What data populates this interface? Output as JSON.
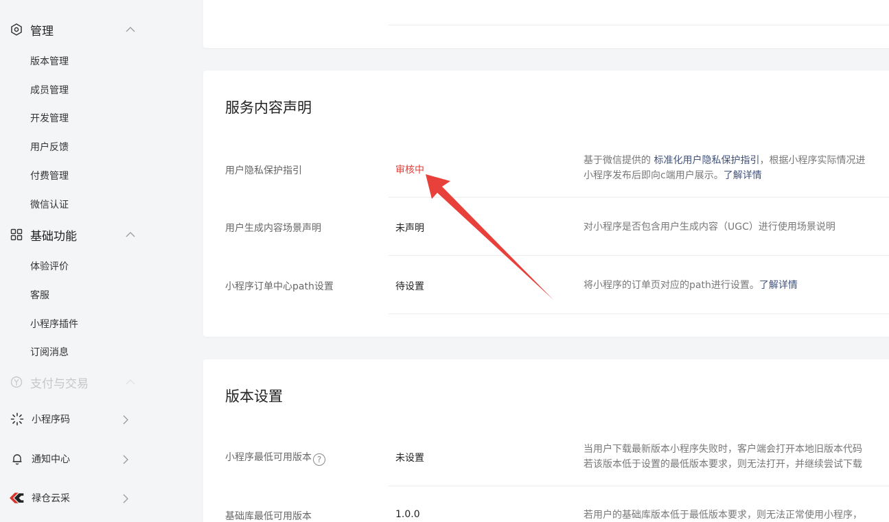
{
  "sidebar": {
    "management": {
      "label": "管理",
      "items": [
        "版本管理",
        "成员管理",
        "开发管理",
        "用户反馈",
        "付费管理",
        "微信认证"
      ]
    },
    "basic": {
      "label": "基础功能",
      "items": [
        "体验评价",
        "客服",
        "小程序插件",
        "订阅消息"
      ]
    },
    "payment": {
      "label": "支付与交易"
    },
    "bottom": [
      {
        "label": "小程序码",
        "icon": "qrcode-icon"
      },
      {
        "label": "通知中心",
        "icon": "bell-icon"
      },
      {
        "label": "禄仓云采",
        "icon": "brand-logo-icon"
      }
    ]
  },
  "service_card": {
    "title": "服务内容声明",
    "rows": [
      {
        "label": "用户隐私保护指引",
        "value": "审核中",
        "desc_prefix": "基于微信提供的",
        "desc_link1": "标准化用户隐私保护指引",
        "desc_mid": "，根据小程序实际情况进",
        "desc_line2": "小程序发布后即向c端用户展示。",
        "desc_link2": "了解详情"
      },
      {
        "label": "用户生成内容场景声明",
        "value": "未声明",
        "desc": "对小程序是否包含用户生成内容（UGC）进行使用场景说明"
      },
      {
        "label": "小程序订单中心path设置",
        "value": "待设置",
        "desc": "将小程序的订单页对应的path进行设置。",
        "desc_link": "了解详情"
      }
    ]
  },
  "version_card": {
    "title": "版本设置",
    "rows": [
      {
        "label": "小程序最低可用版本",
        "help": "?",
        "value": "未设置",
        "desc_line1": "当用户下载最新版本小程序失败时，客户端会打开本地旧版本代码",
        "desc_line2": "若该版本低于设置的最低版本要求，则无法打开，并继续尝试下载"
      },
      {
        "label": "基础库最低可用版本",
        "value": "1.0.0",
        "desc_line1": "若用户的基础库版本低于最低版本要求，则无法正常使用小程序，"
      }
    ]
  },
  "colors": {
    "status_review": "#e0403a",
    "link": "#41527c",
    "annotation_arrow": "#e8403a"
  }
}
